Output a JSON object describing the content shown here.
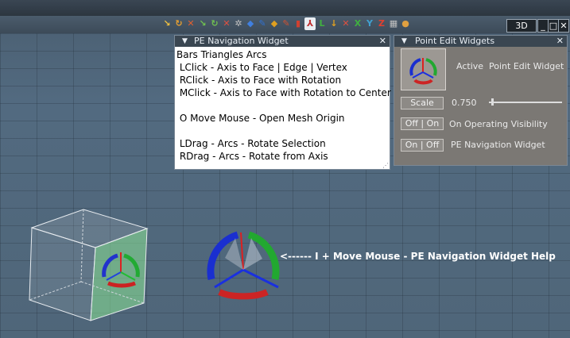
{
  "toolbar": {
    "view_label": "3D",
    "tools": [
      {
        "name": "pe-tool-1",
        "glyph": "↘",
        "color": "#f0c040"
      },
      {
        "name": "pe-tool-2",
        "glyph": "↻",
        "color": "#e8a030"
      },
      {
        "name": "pe-tool-3",
        "glyph": "✕",
        "color": "#e06030"
      },
      {
        "name": "pe-tool-4",
        "glyph": "↘",
        "color": "#70c050"
      },
      {
        "name": "pe-tool-5",
        "glyph": "↻",
        "color": "#70c050"
      },
      {
        "name": "pe-tool-6",
        "glyph": "✕",
        "color": "#e05040"
      },
      {
        "name": "pe-tool-7",
        "glyph": "✲",
        "color": "#c0c0c0"
      },
      {
        "name": "pe-tool-8",
        "glyph": "◆",
        "color": "#4080e0"
      },
      {
        "name": "pe-tool-9",
        "glyph": "✎",
        "color": "#3070d0"
      },
      {
        "name": "pe-tool-10",
        "glyph": "◆",
        "color": "#e0a020"
      },
      {
        "name": "pe-tool-11",
        "glyph": "✎",
        "color": "#d05030"
      },
      {
        "name": "pe-tool-12",
        "glyph": "▮",
        "color": "#d04030"
      },
      {
        "name": "pe-tool-13",
        "glyph": "⅄",
        "color": "#c03030",
        "selected": true
      },
      {
        "name": "pe-tool-14",
        "glyph": "L",
        "color": "#40b040"
      },
      {
        "name": "pe-tool-15",
        "glyph": "↓",
        "color": "#e0a020"
      },
      {
        "name": "pe-tool-16",
        "glyph": "✕",
        "color": "#e05040"
      },
      {
        "name": "pe-tool-17",
        "glyph": "X",
        "color": "#40b040"
      },
      {
        "name": "pe-tool-18",
        "glyph": "Y",
        "color": "#40a0d0"
      },
      {
        "name": "pe-tool-19",
        "glyph": "Z",
        "color": "#e04030"
      },
      {
        "name": "pe-tool-20",
        "glyph": "▦",
        "color": "#c0c0c0"
      },
      {
        "name": "pe-tool-21",
        "glyph": "●",
        "color": "#e0a040"
      }
    ]
  },
  "nav_widget": {
    "title": "PE Navigation Widget",
    "lines": [
      "Bars Triangles Arcs",
      " LClick - Axis to Face | Edge | Vertex",
      " RClick - Axis to Face with Rotation",
      " MClick - Axis to Face with Rotation to Center",
      "",
      " O Move Mouse - Open Mesh Origin",
      "",
      " LDrag - Arcs - Rotate Selection",
      " RDrag - Arcs - Rotate from Axis"
    ]
  },
  "pe_widgets": {
    "title": "Point Edit Widgets",
    "active_label": "Active",
    "active_value": "Point Edit Widget",
    "scale_button": "Scale",
    "scale_value": "0.750",
    "scale_fraction": 0.04,
    "visibility_button": "Off | On",
    "visibility_label": "On Operating Visibility",
    "nav_button": "On | Off",
    "nav_label": "PE Navigation Widget"
  },
  "help_text": "<------ I + Move Mouse - PE Navigation Widget Help"
}
